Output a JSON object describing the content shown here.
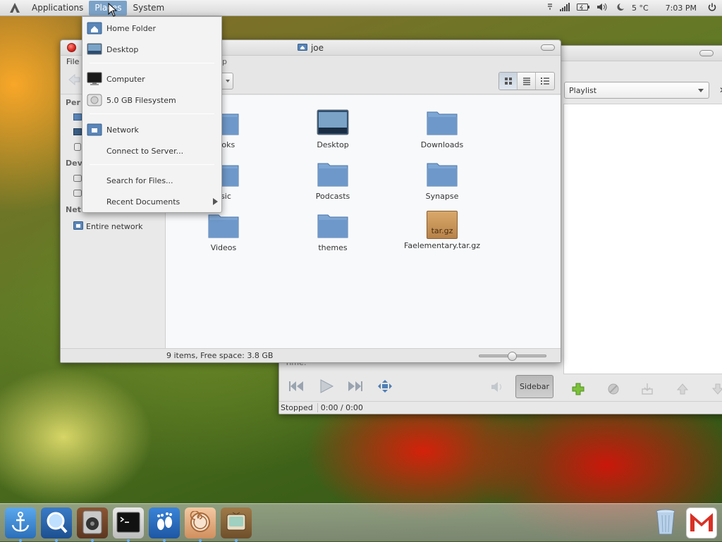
{
  "panel": {
    "applications_label": "Applications",
    "places_label": "Places",
    "system_label": "System",
    "weather": "5 °C",
    "clock": "7:03 PM"
  },
  "places_menu": {
    "items": [
      {
        "label": "Home Folder",
        "icon": "home-folder-icon"
      },
      {
        "label": "Desktop",
        "icon": "desktop-icon"
      },
      {
        "label": "Computer",
        "icon": "computer-icon"
      },
      {
        "label": "5.0 GB Filesystem",
        "icon": "harddisk-icon"
      },
      {
        "label": "Network",
        "icon": "network-icon"
      },
      {
        "label": "Connect to Server...",
        "icon": ""
      },
      {
        "label": "Search for Files...",
        "icon": ""
      },
      {
        "label": "Recent Documents",
        "icon": "submenu-arrow-icon"
      }
    ]
  },
  "file_manager": {
    "title": "joe",
    "menubar": {
      "file": "File",
      "partial": "p"
    },
    "sidebar": {
      "sections": [
        "Per",
        "Dev",
        "Net"
      ],
      "network_item": "Entire network"
    },
    "files": [
      {
        "name": "books",
        "type": "folder"
      },
      {
        "name": "Desktop",
        "type": "desktop"
      },
      {
        "name": "Downloads",
        "type": "folder"
      },
      {
        "name": "usic",
        "type": "folder"
      },
      {
        "name": "Podcasts",
        "type": "folder"
      },
      {
        "name": "Synapse",
        "type": "folder"
      },
      {
        "name": "Videos",
        "type": "folder"
      },
      {
        "name": "themes",
        "type": "folder"
      },
      {
        "name": "Faelementary.tar.gz",
        "type": "archive",
        "archive_label": "tar.gz"
      }
    ],
    "status": "9 items, Free space: 3.8 GB"
  },
  "media_player": {
    "playlist_select": "Playlist",
    "time_label": "Time:",
    "sidebar_button": "Sidebar",
    "status": "Stopped",
    "position": "0:00 / 0:00"
  },
  "colors": {
    "accent": "#7ba2c8",
    "folder_blue": "#5b86b8",
    "close_red": "#d7261c"
  }
}
